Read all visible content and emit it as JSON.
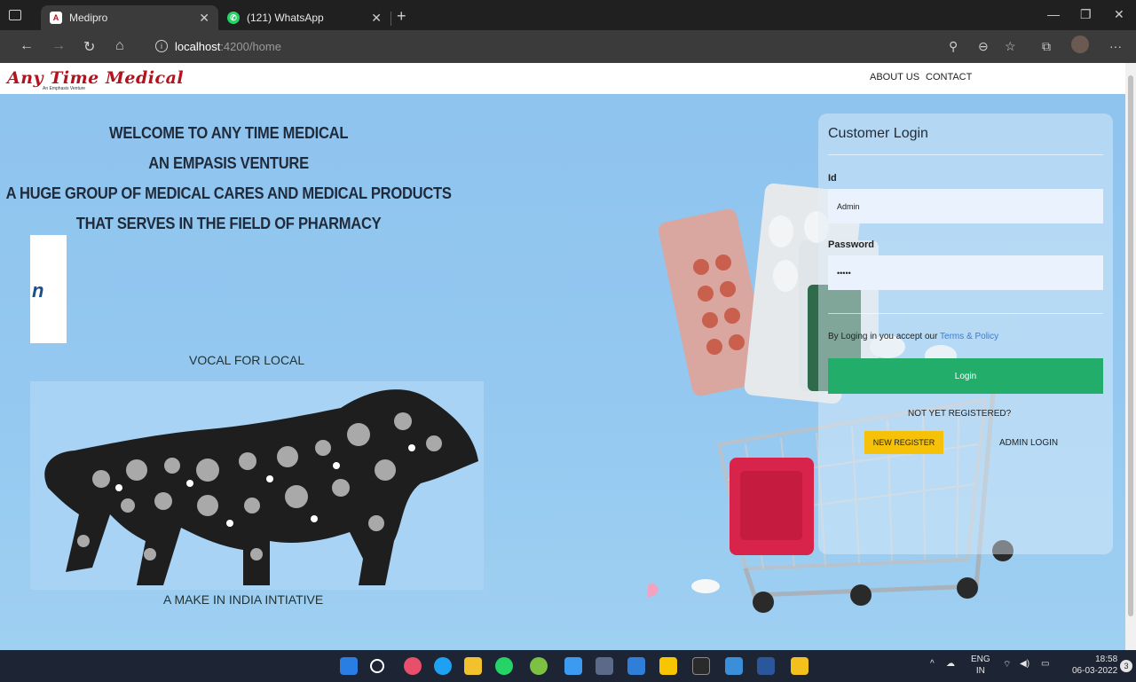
{
  "browser": {
    "tabs": [
      {
        "title": "Medipro",
        "icon": "angular-icon",
        "active": true
      },
      {
        "title": "(121) WhatsApp",
        "icon": "whatsapp-icon",
        "active": false
      }
    ],
    "url": {
      "host": "localhost",
      "path": ":4200/home"
    },
    "icons": [
      "back-icon",
      "forward-icon",
      "reload-icon",
      "home-icon",
      "info-icon",
      "read-aloud-icon",
      "zoom-icon",
      "favorite-icon",
      "collections-icon",
      "profile-icon",
      "more-icon"
    ]
  },
  "site": {
    "logo": "Any Time Medical",
    "logo_sub": "An Emphasis Venture",
    "nav": {
      "about": "ABOUT US",
      "contact": "CONTACT"
    }
  },
  "hero": {
    "lines": [
      "WELCOME TO ANY TIME MEDICAL",
      "AN EMPASIS VENTURE",
      "A HUGE GROUP OF MEDICAL CARES AND MEDICAL PRODUCTS",
      "THAT SERVES IN THE FIELD OF PHARMACY"
    ],
    "box_fragment": "n",
    "vocal": "VOCAL FOR LOCAL",
    "make_in_india": "A MAKE IN INDIA INTIATIVE"
  },
  "login": {
    "title": "Customer Login",
    "id_label": "Id",
    "id_value": "Admin",
    "password_label": "Password",
    "password_value": "•••••",
    "accept_prefix": "By Loging in you accept our ",
    "accept_link": "Terms & Policy",
    "login_button": "Login",
    "not_registered": "NOT YET REGISTERED?",
    "register_button": "NEW REGISTER",
    "admin_login": "ADMIN LOGIN"
  },
  "taskbar": {
    "lang_top": "ENG",
    "lang_bottom": "IN",
    "time": "18:58",
    "date": "06-03-2022",
    "notifications": "3",
    "colors": [
      "#2a7de1",
      "#ffffff",
      "#e94f6b",
      "#1ea1f2",
      "#f2c12e",
      "#25d366",
      "#7cc142",
      "#3c9bf0",
      "#5a6a88",
      "#2f7ed8",
      "#f7c600",
      "#2a2a2a",
      "#3b8fd8",
      "#2b579a",
      "#f4c01e"
    ]
  }
}
